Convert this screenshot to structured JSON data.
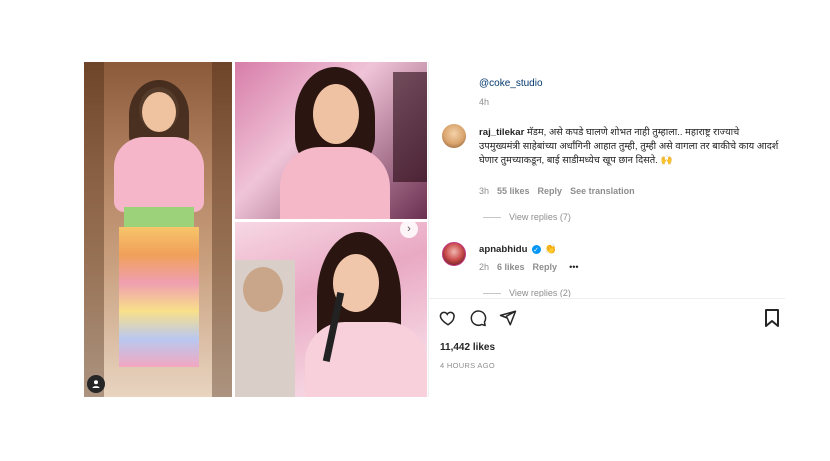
{
  "comments": {
    "top_mention": "@coke_studio",
    "top_time": "4h",
    "first": {
      "username": "raj_tilekar",
      "text": "मॅडम, असे कपडे घालणे शोभत नाही तुम्हाला.. महाराष्ट्र राज्याचे उपमुख्यमंत्री साहेबांच्या अर्धांगिनी आहात तुम्ही, तुम्ही असे वागला तर बाकीचे काय आदर्श घेणार तुमच्याकडून, बाई साडीमध्येच खूप छान दिसते. 🙌",
      "time": "3h",
      "likes": "55 likes",
      "reply": "Reply",
      "translate": "See translation",
      "view_replies": "View replies (7)"
    },
    "second": {
      "username": "apnabhidu",
      "emoji": "👏",
      "time": "2h",
      "likes": "6 likes",
      "reply": "Reply",
      "more": "•••",
      "view_replies": "View replies (2)"
    }
  },
  "post": {
    "likes": "11,442 likes",
    "posted": "4 HOURS AGO"
  },
  "icons": {
    "like": "heart-icon",
    "comment": "comment-icon",
    "share": "share-icon",
    "save": "bookmark-icon",
    "user_tag": "user-tag-icon",
    "carousel_next": "chevron-right-icon"
  }
}
